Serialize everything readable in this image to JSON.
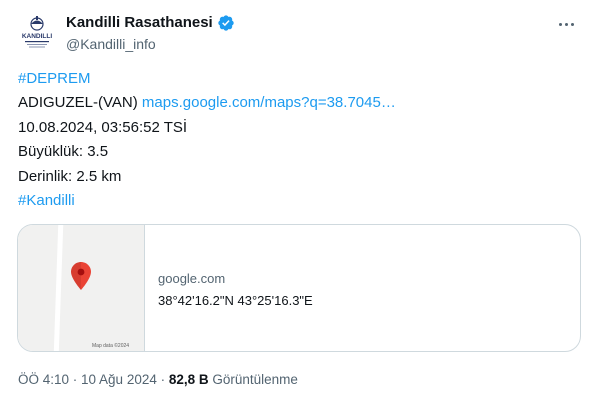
{
  "author": {
    "name": "Kandilli Rasathanesi",
    "handle": "@Kandilli_info",
    "avatar_text": "KANDILLI",
    "verified": true
  },
  "tweet": {
    "lines": [
      {
        "hashtag": "#DEPREM"
      },
      {
        "text": "ADIGUZEL-(VAN) ",
        "link": "maps.google.com/maps?q=38.7045…"
      },
      {
        "text": "10.08.2024, 03:56:52 TSİ"
      },
      {
        "text": "Büyüklük: 3.5"
      },
      {
        "text": "Derinlik: 2.5 km"
      },
      {
        "hashtag": "#Kandilli"
      }
    ]
  },
  "card": {
    "domain": "google.com",
    "title": "38°42'16.2\"N 43°25'16.3\"E",
    "map_credit": "Map data ©2024",
    "pin_color": "#ea4335"
  },
  "meta": {
    "time": "ÖÖ 4:10 · 10 Ağu 2024",
    "separator": " · ",
    "views_count": "82,8 B",
    "views_label": " Görüntülenme"
  },
  "colors": {
    "link": "#1d9bf0",
    "verified": "#1d9bf0",
    "secondary_text": "#536471"
  }
}
